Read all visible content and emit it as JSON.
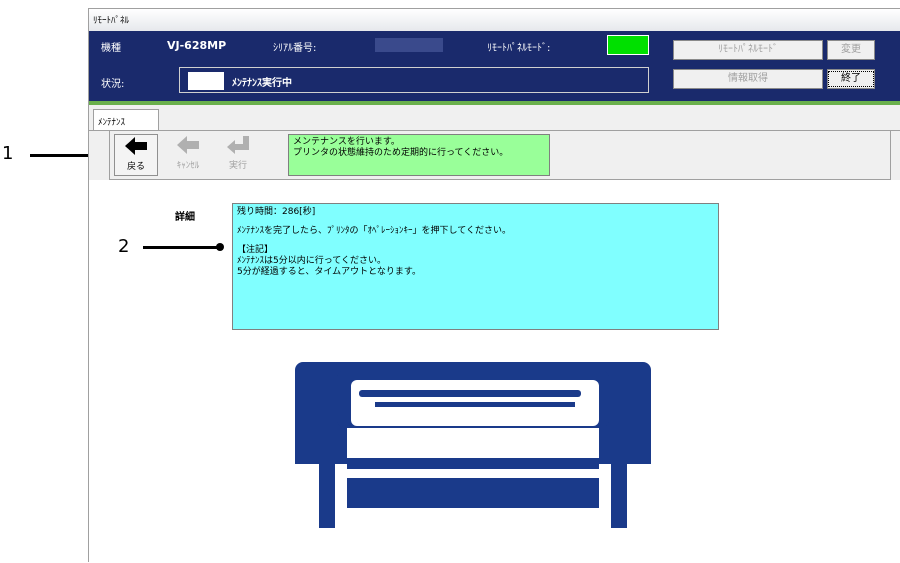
{
  "window": {
    "title": "ﾘﾓｰﾄﾊﾟﾈﾙ"
  },
  "header": {
    "model_label": "機種",
    "model_value": "VJ-628MP",
    "serial_label": "ｼﾘｱﾙ番号:",
    "remote_mode_label": "ﾘﾓｰﾄﾊﾟﾈﾙﾓｰﾄﾞ:",
    "remote_mode_color": "#00e000",
    "status_label": "状況:",
    "status_value": "ﾒﾝﾃﾅﾝｽ実行中",
    "buttons": {
      "remote_mode": "ﾘﾓｰﾄﾊﾟﾈﾙﾓｰﾄﾞ",
      "change": "変更",
      "get_info": "情報取得",
      "exit": "終了"
    }
  },
  "tab": {
    "label": "ﾒﾝﾃﾅﾝｽ"
  },
  "toolbar": {
    "back_label": "戻る",
    "cancel_label": "ｷｬﾝｾﾙ",
    "execute_label": "実行",
    "message_line1": "メンテナンスを行います。",
    "message_line2": "プリンタの状態維持のため定期的に行ってください。",
    "message_color": "#99ff99"
  },
  "detail": {
    "label": "詳細",
    "remaining": "残り時間：286[秒]",
    "instruction": "ﾒﾝﾃﾅﾝｽを完了したら、ﾌﾟﾘﾝﾀの「ｵﾍﾟﾚｰｼｮﾝｷｰ」を押下してください。",
    "note_title": "【注記】",
    "note_line1": "ﾒﾝﾃﾅﾝｽは5分以内に行ってください。",
    "note_line2": "5分が経過すると、タイムアウトとなります。",
    "box_color": "#80ffff"
  },
  "callouts": {
    "one": "1",
    "two": "2"
  },
  "colors": {
    "header_bg": "#1a2a6c",
    "accent_line": "#6ab04c",
    "printer": "#1a3a8a"
  }
}
